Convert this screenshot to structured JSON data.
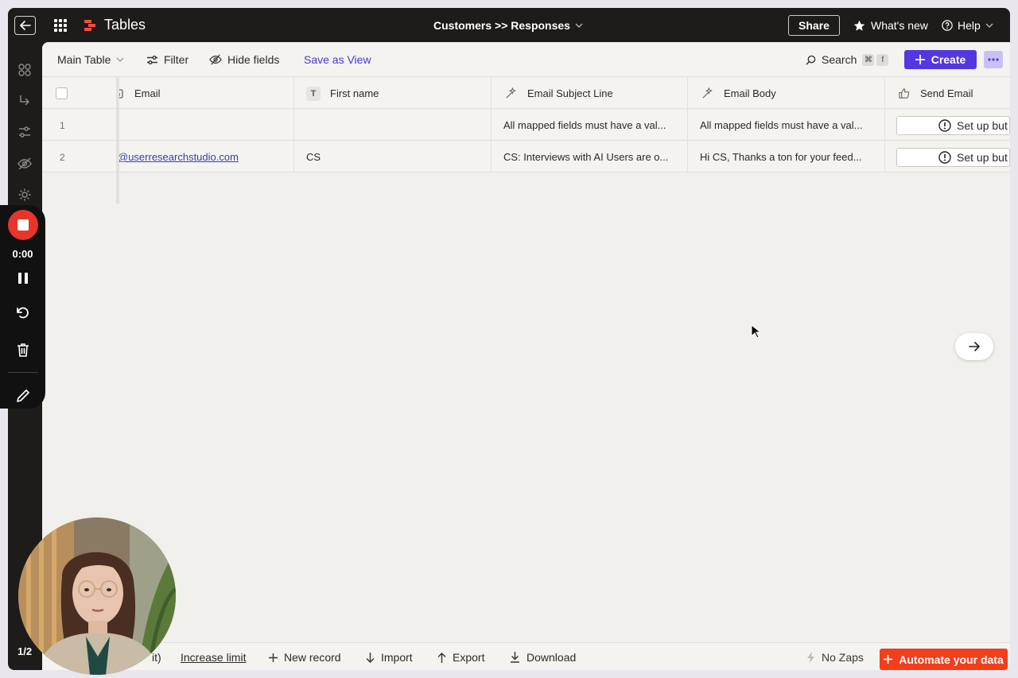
{
  "topbar": {
    "app_title": "Tables",
    "breadcrumb": "Customers >> Responses",
    "share_label": "Share",
    "whats_new_label": "What's new",
    "help_label": "Help"
  },
  "toolbar": {
    "view_label": "Main Table",
    "filter_label": "Filter",
    "hide_fields_label": "Hide fields",
    "save_view_label": "Save as View",
    "search_label": "Search",
    "search_shortcut": [
      "⌘",
      "f"
    ],
    "create_label": "Create"
  },
  "columns": [
    {
      "label": "Email",
      "icon": "email-field-icon"
    },
    {
      "label": "First name",
      "icon": "text-field-icon",
      "icon_text": "T"
    },
    {
      "label": "Email Subject Line",
      "icon": "ai-field-icon"
    },
    {
      "label": "Email Body",
      "icon": "ai-field-icon"
    },
    {
      "label": "Send Email",
      "icon": "button-field-icon"
    }
  ],
  "rows": [
    {
      "num": "1",
      "email": "",
      "first_name": "",
      "subject": "All mapped fields must have a val...",
      "body": "All mapped fields must have a val...",
      "send": "Set up but"
    },
    {
      "num": "2",
      "email": "@userresearchstudio.com",
      "first_name": "CS",
      "subject": "CS: Interviews with AI Users are o...",
      "body": "Hi CS, Thanks a ton for your feed...",
      "send": "Set up but"
    }
  ],
  "footer": {
    "limit_partial": "it)",
    "increase_limit_label": "Increase limit",
    "new_record_label": "New record",
    "import_label": "Import",
    "export_label": "Export",
    "download_label": "Download",
    "no_zaps_label": "No Zaps",
    "automate_label": "Automate your data"
  },
  "recorder": {
    "time": "0:00",
    "pager": "1/2"
  },
  "colors": {
    "accent": "#5636e0",
    "automate": "#f23e1a",
    "record": "#e8352c",
    "dark_bg": "#1d1c1b"
  }
}
